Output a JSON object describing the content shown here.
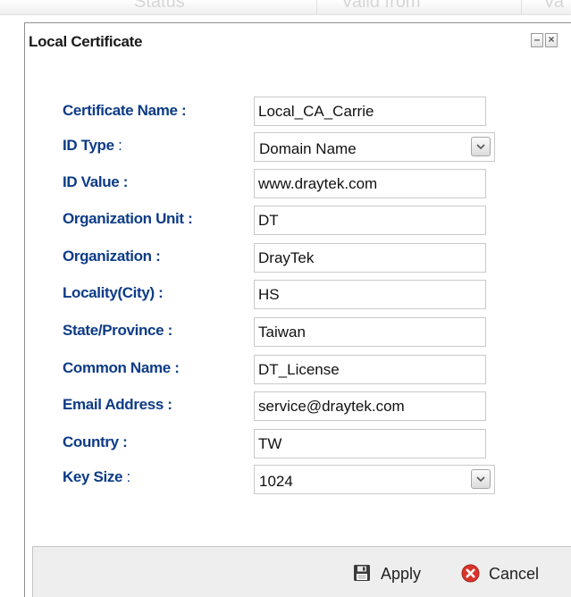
{
  "background_header": {
    "columns": [
      "Status",
      "Valid from",
      "Va"
    ]
  },
  "dialog": {
    "title": "Local Certificate",
    "minimize_symbol": "–",
    "close_symbol": "×"
  },
  "form": {
    "certificate_name": {
      "label": "Certificate Name :",
      "value": "Local_CA_Carrie"
    },
    "id_type": {
      "label": "ID Type",
      "sep": " :",
      "selected": "Domain Name"
    },
    "id_value": {
      "label": "ID Value :",
      "value": "www.draytek.com"
    },
    "organization_unit": {
      "label": "Organization Unit :",
      "value": "DT"
    },
    "organization": {
      "label": "Organization :",
      "value": "DrayTek"
    },
    "locality": {
      "label": "Locality(City) :",
      "value": "HS"
    },
    "state": {
      "label": "State/Province :",
      "value": "Taiwan"
    },
    "common_name": {
      "label": "Common Name :",
      "value": "DT_License"
    },
    "email": {
      "label": "Email Address :",
      "value": "service@draytek.com"
    },
    "country": {
      "label": "Country :",
      "value": "TW"
    },
    "key_size": {
      "label": "Key Size",
      "sep": " :",
      "selected": "1024"
    }
  },
  "footer": {
    "apply_label": "Apply",
    "cancel_label": "Cancel"
  },
  "icons": {
    "apply": "floppy-disk-icon",
    "cancel": "red-x-circle-icon",
    "dropdown": "chevron-down-icon"
  },
  "colors": {
    "label": "#0d3b86",
    "cancel_icon": "#d9352a",
    "footer_bg": "#eeeeee"
  }
}
